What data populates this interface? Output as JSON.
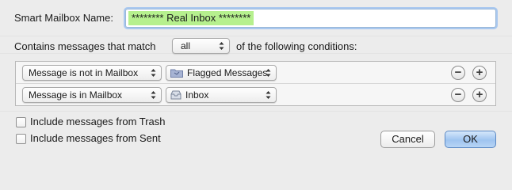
{
  "name_row": {
    "label": "Smart Mailbox Name:",
    "value": "******** Real Inbox ********"
  },
  "match_row": {
    "prefix": "Contains messages that match",
    "selected": "all",
    "suffix": "of the following conditions:"
  },
  "conditions": [
    {
      "criterion": "Message is not in Mailbox",
      "mailbox": "Flagged Messages",
      "mailbox_icon": "folder-icon"
    },
    {
      "criterion": "Message is in Mailbox",
      "mailbox": "Inbox",
      "mailbox_icon": "inbox-tray-icon"
    }
  ],
  "options": {
    "trash_label": "Include messages from Trash",
    "sent_label": "Include messages from Sent"
  },
  "buttons": {
    "cancel": "Cancel",
    "ok": "OK",
    "remove_symbol": "−",
    "add_symbol": "+"
  },
  "colors": {
    "name_highlight": "#b6f08e",
    "default_button": "#9fc4f0"
  }
}
